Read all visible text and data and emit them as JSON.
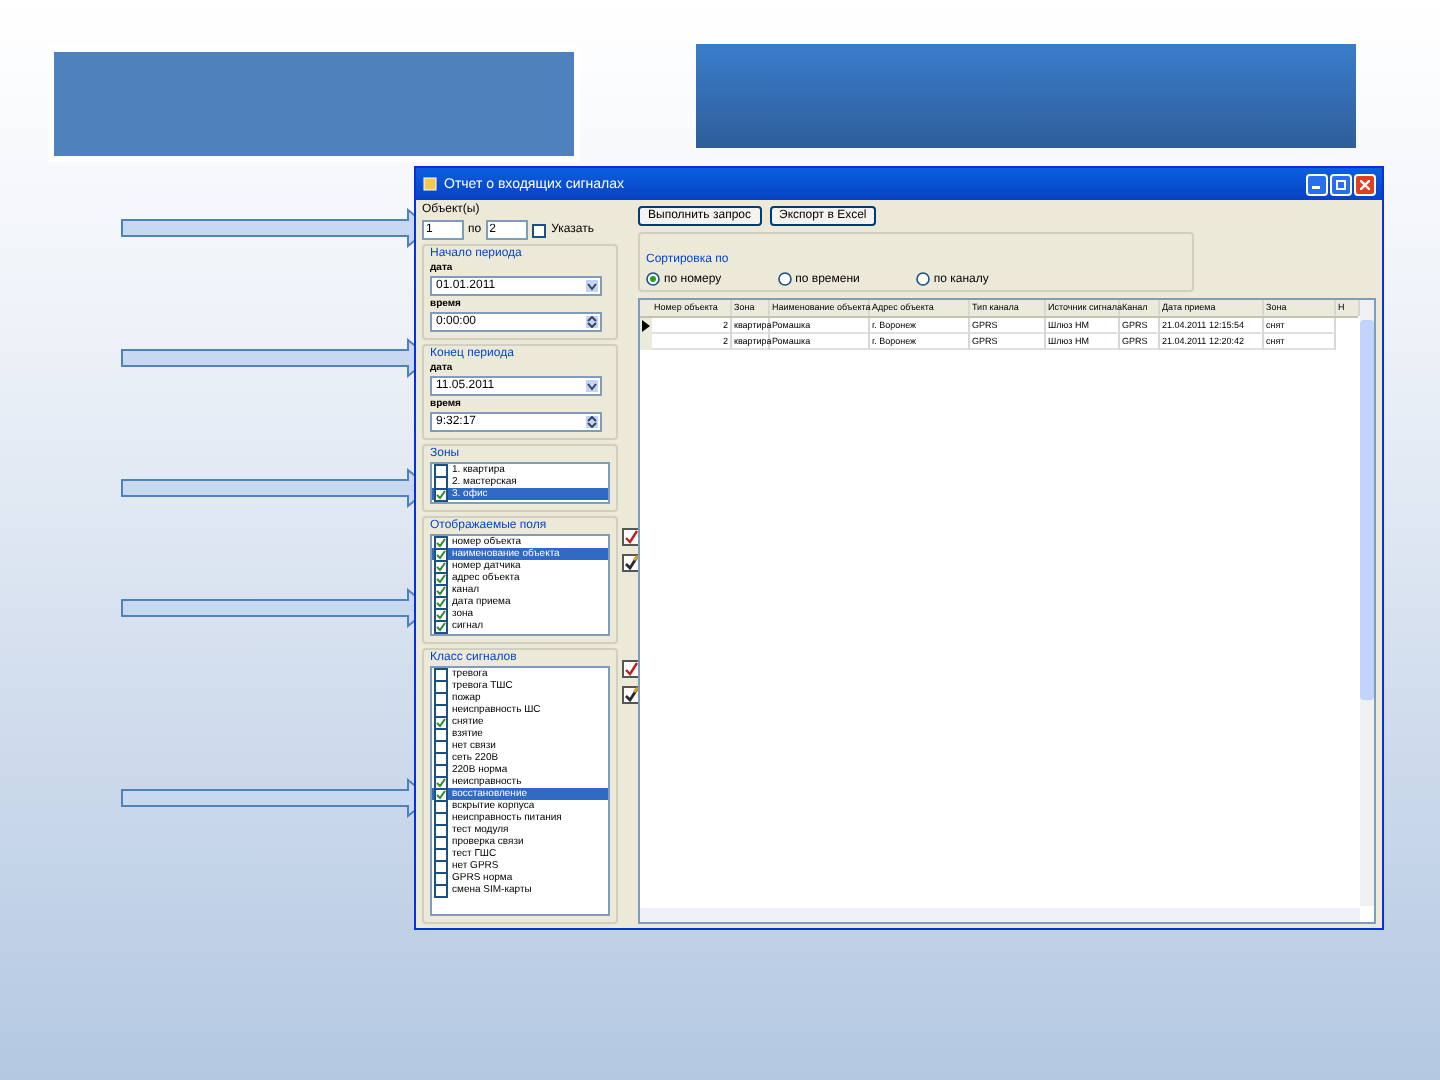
{
  "window": {
    "title": "Отчет о входящих сигналах"
  },
  "objects": {
    "label": "Объект(ы)",
    "from": "1",
    "to_label": "по",
    "to": "2",
    "specify": {
      "label": "Указать",
      "checked": false
    }
  },
  "start": {
    "label": "Начало периода",
    "date_label": "дата",
    "date": "01.01.2011",
    "time_label": "время",
    "time": "0:00:00"
  },
  "end": {
    "label": "Конец периода",
    "date_label": "дата",
    "date": "11.05.2011",
    "time_label": "время",
    "time": "9:32:17"
  },
  "zones": {
    "label": "Зоны",
    "items": [
      {
        "label": "1. квартира",
        "checked": false,
        "selected": false
      },
      {
        "label": "2. мастерская",
        "checked": false,
        "selected": false
      },
      {
        "label": "3. офис",
        "checked": true,
        "selected": true
      }
    ]
  },
  "fields": {
    "label": "Отображаемые поля",
    "items": [
      {
        "label": "номер объекта",
        "checked": true,
        "selected": false
      },
      {
        "label": "наименование объекта",
        "checked": true,
        "selected": true
      },
      {
        "label": "номер датчика",
        "checked": true,
        "selected": false
      },
      {
        "label": "адрес объекта",
        "checked": true,
        "selected": false
      },
      {
        "label": "канал",
        "checked": true,
        "selected": false
      },
      {
        "label": "дата приема",
        "checked": true,
        "selected": false
      },
      {
        "label": "зона",
        "checked": true,
        "selected": false
      },
      {
        "label": "сигнал",
        "checked": true,
        "selected": false
      }
    ]
  },
  "classes": {
    "label": "Класс сигналов",
    "items": [
      {
        "label": "тревога",
        "checked": false,
        "selected": false
      },
      {
        "label": "тревога ТШС",
        "checked": false,
        "selected": false
      },
      {
        "label": "пожар",
        "checked": false,
        "selected": false
      },
      {
        "label": "неисправность ШС",
        "checked": false,
        "selected": false
      },
      {
        "label": "снятие",
        "checked": true,
        "selected": false
      },
      {
        "label": "взятие",
        "checked": false,
        "selected": false
      },
      {
        "label": "нет связи",
        "checked": false,
        "selected": false
      },
      {
        "label": "сеть 220В",
        "checked": false,
        "selected": false
      },
      {
        "label": "220В норма",
        "checked": false,
        "selected": false
      },
      {
        "label": "неисправность",
        "checked": true,
        "selected": false
      },
      {
        "label": "восстановление",
        "checked": true,
        "selected": true
      },
      {
        "label": "вскрытие корпуса",
        "checked": false,
        "selected": false
      },
      {
        "label": "неисправность питания",
        "checked": false,
        "selected": false
      },
      {
        "label": "тест модуля",
        "checked": false,
        "selected": false
      },
      {
        "label": "проверка связи",
        "checked": false,
        "selected": false
      },
      {
        "label": "тест ГШС",
        "checked": false,
        "selected": false
      },
      {
        "label": "нет GPRS",
        "checked": false,
        "selected": false
      },
      {
        "label": "GPRS норма",
        "checked": false,
        "selected": false
      },
      {
        "label": "смена SIM-карты",
        "checked": false,
        "selected": false
      }
    ]
  },
  "buttons": [
    "Выполнить запрос",
    "Экспорт в Excel"
  ],
  "sort": {
    "label": "Сортировка по",
    "options": [
      {
        "label": "по номеру",
        "selected": true
      },
      {
        "label": "по времени",
        "selected": false
      },
      {
        "label": "по каналу",
        "selected": false
      }
    ]
  },
  "table": {
    "columns": [
      "Номер объекта",
      "Зона",
      "Наименование объекта",
      "Адрес объекта",
      "Тип канала",
      "Источник сигнала",
      "Канал",
      "Дата приема",
      "Зона",
      "Н"
    ],
    "rows": [
      {
        "selected": true,
        "cells": [
          "2",
          "квартира",
          "Ромашка",
          "г. Воронеж",
          "GPRS",
          "Шлюз НМ",
          "GPRS",
          "21.04.2011 12:15:54",
          "снят"
        ]
      },
      {
        "selected": false,
        "cells": [
          "2",
          "квартира",
          "Ромашка",
          "г. Воронеж",
          "GPRS",
          "Шлюз НМ",
          "GPRS",
          "21.04.2011 12:20:42",
          "снят"
        ]
      }
    ]
  }
}
